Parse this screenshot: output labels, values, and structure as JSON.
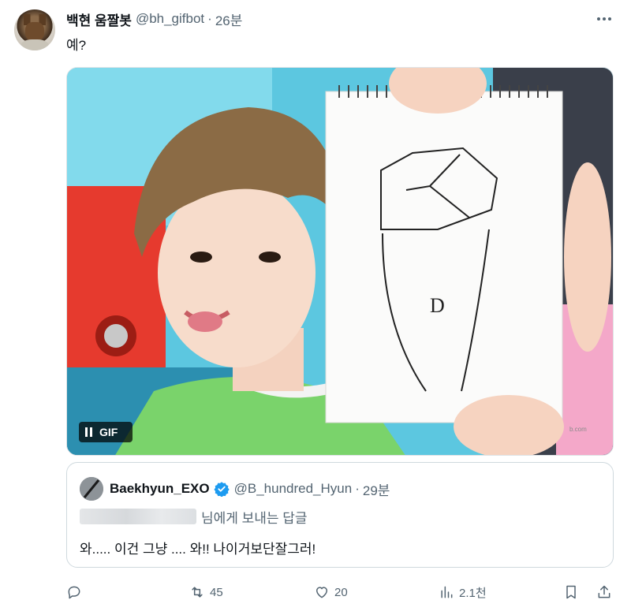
{
  "tweet": {
    "display_name": "백현 움짤봇",
    "handle": "@bh_gifbot",
    "separator": "·",
    "time": "26분",
    "text": "예?"
  },
  "media": {
    "badge_label": "GIF",
    "watermark": "b.com",
    "sketch_letter": "D"
  },
  "quote": {
    "display_name": "Baekhyun_EXO",
    "handle": "@B_hundred_Hyun",
    "separator": "·",
    "time": "29분",
    "reply_suffix": "님에게 보내는 답글",
    "text": "와..... 이건 그냥 .... 와!! 나이거보단잘그러!"
  },
  "actions": {
    "reply_count": "",
    "retweet_count": "45",
    "like_count": "20",
    "views_count": "2.1천"
  },
  "icons": {
    "more": "more-icon",
    "verified": "verified-badge-icon",
    "reply": "reply-icon",
    "retweet": "retweet-icon",
    "like": "heart-icon",
    "views": "views-icon",
    "bookmark": "bookmark-icon",
    "share": "share-icon",
    "pause": "pause-icon"
  },
  "colors": {
    "text_primary": "#0f1419",
    "text_secondary": "#536471",
    "verified_blue": "#1d9bf0",
    "border": "#cfd9de"
  }
}
